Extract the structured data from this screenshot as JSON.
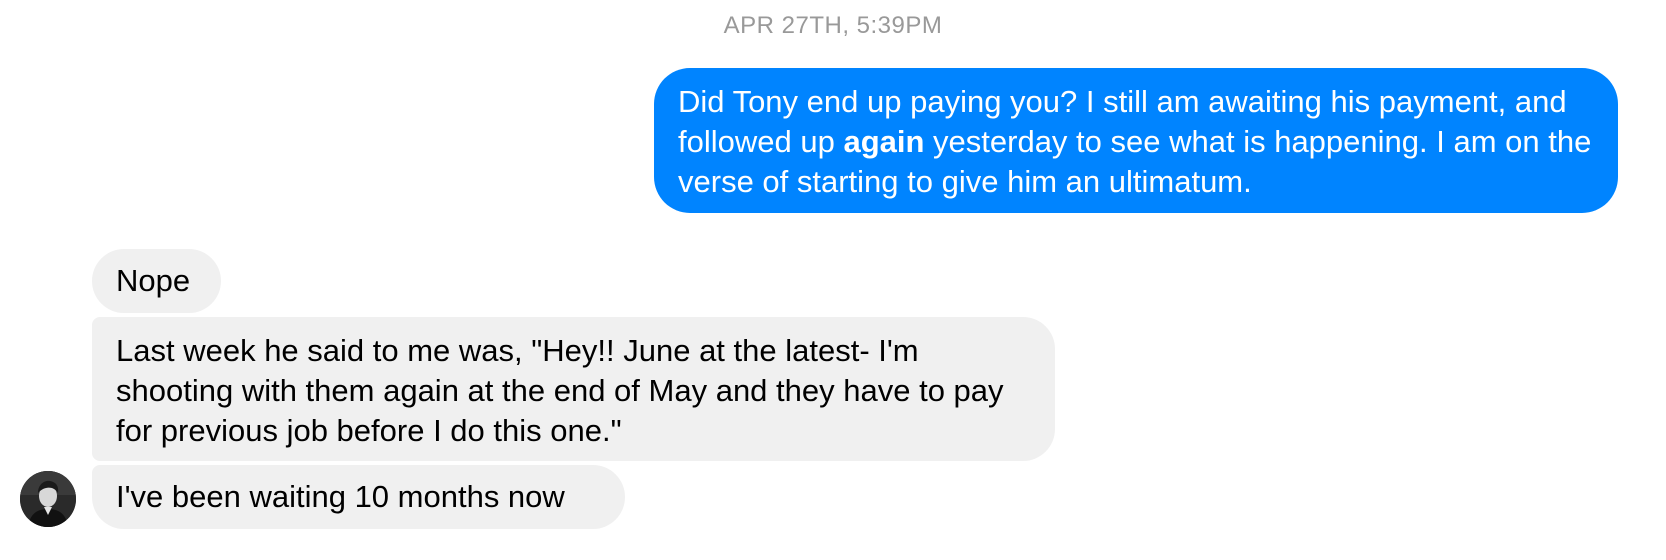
{
  "conversation": {
    "timestamp": "APR 27TH, 5:39PM",
    "outgoing": {
      "part1": "Did Tony end up paying you? I still am awaiting his payment, and followed up ",
      "bold": "again",
      "part2": " yesterday to see what is happening. I am on the verse of starting to give him an ultimatum."
    },
    "incoming": [
      {
        "text": "Nope"
      },
      {
        "text": "Last week he said to me was, \"Hey!! June at the latest- I'm shooting with them again at the end of May and they have to pay for previous job before I do this one.\""
      },
      {
        "text": "I've been waiting 10 months now"
      }
    ]
  },
  "colors": {
    "outgoing_bubble": "#0084ff",
    "incoming_bubble": "#f0f0f0",
    "timestamp_text": "#999999"
  },
  "icons": {
    "sender_avatar": "avatar"
  }
}
